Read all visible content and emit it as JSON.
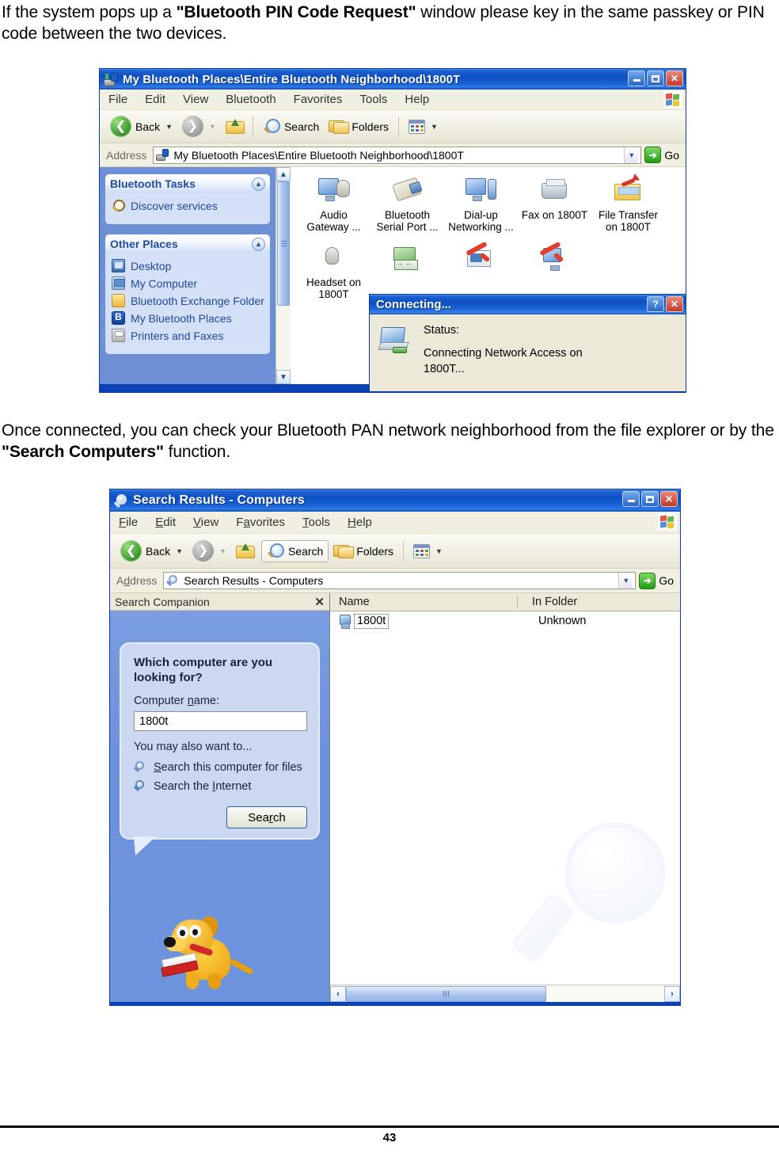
{
  "document": {
    "paragraph1_pre": "If the system pops up a ",
    "paragraph1_bold": "\"Bluetooth PIN Code Request\"",
    "paragraph1_post": " window please key in the same passkey or PIN code between the two devices.",
    "paragraph2_pre": "Once connected, you can check your Bluetooth PAN network neighborhood from the file explorer or by the ",
    "paragraph2_bold": "\"Search Computers\"",
    "paragraph2_post": " function.",
    "page_number": "43"
  },
  "window1": {
    "title": "My Bluetooth Places\\Entire Bluetooth Neighborhood\\1800T",
    "title_icon": "bluetooth-places-icon",
    "window_buttons": {
      "minimize": "minimize-button",
      "maximize": "maximize-button",
      "close": "close-button"
    },
    "menu": [
      "File",
      "Edit",
      "View",
      "Bluetooth",
      "Favorites",
      "Tools",
      "Help"
    ],
    "toolbar": {
      "back_label": "Back",
      "forward_label": "",
      "up_label": "",
      "search_label": "Search",
      "folders_label": "Folders",
      "views_label": ""
    },
    "address": {
      "label": "Address",
      "value": "My Bluetooth Places\\Entire Bluetooth Neighborhood\\1800T",
      "go_label": "Go"
    },
    "taskpanes": [
      {
        "header": "Bluetooth Tasks",
        "items": [
          {
            "icon": "magnifier-icon",
            "label": "Discover services"
          }
        ]
      },
      {
        "header": "Other Places",
        "items": [
          {
            "icon": "desktop-icon",
            "label": "Desktop"
          },
          {
            "icon": "my-computer-icon",
            "label": "My Computer"
          },
          {
            "icon": "folder-icon",
            "label": "Bluetooth Exchange Folder"
          },
          {
            "icon": "bluetooth-icon",
            "label": "My Bluetooth Places"
          },
          {
            "icon": "printer-icon",
            "label": "Printers and Faxes"
          }
        ]
      }
    ],
    "devices": [
      {
        "icon": "audio-gateway-icon",
        "label_line1": "Audio",
        "label_line2": "Gateway ..."
      },
      {
        "icon": "serial-port-icon",
        "label_line1": "Bluetooth",
        "label_line2": "Serial Port ..."
      },
      {
        "icon": "dialup-networking-icon",
        "label_line1": "Dial-up",
        "label_line2": "Networking ..."
      },
      {
        "icon": "fax-icon",
        "label_line1": "Fax on 1800T",
        "label_line2": ""
      },
      {
        "icon": "file-transfer-icon",
        "label_line1": "File Transfer",
        "label_line2": "on 1800T"
      },
      {
        "icon": "headset-icon",
        "label_line1": "Headset on",
        "label_line2": "1800T"
      },
      {
        "icon": "network-access-icon",
        "label_line1": "",
        "label_line2": ""
      },
      {
        "icon": "pim-item-transfer-icon",
        "label_line1": "",
        "label_line2": ""
      },
      {
        "icon": "pim-synchronization-icon",
        "label_line1": "",
        "label_line2": ""
      }
    ]
  },
  "dialog": {
    "title": "Connecting...",
    "help_label": "?",
    "close_label": "✕",
    "status_label": "Status:",
    "status_text": "Connecting Network Access on 1800T...",
    "icon": "network-connection-icon"
  },
  "window2": {
    "title": "Search Results  - Computers",
    "title_icon": "search-results-icon",
    "menu": [
      "File",
      "Edit",
      "View",
      "Favorites",
      "Tools",
      "Help"
    ],
    "toolbar": {
      "back_label": "Back",
      "search_label": "Search",
      "folders_label": "Folders"
    },
    "address": {
      "label": "Address",
      "value": "Search Results - Computers",
      "go_label": "Go"
    },
    "search_companion": {
      "header": "Search Companion",
      "close_label": "✕",
      "question": "Which computer are you looking for?",
      "name_label": "Computer name:",
      "name_value": "1800t",
      "also_label": "You may also want to...",
      "links": [
        {
          "icon": "search-files-icon",
          "label": "Search this computer for files"
        },
        {
          "icon": "search-internet-icon",
          "label": "Search the Internet"
        }
      ],
      "search_button": "Search",
      "mascot": "dog-mascot-icon"
    },
    "results": {
      "columns": [
        "Name",
        "In Folder"
      ],
      "rows": [
        {
          "name": "1800t",
          "in_folder": "Unknown",
          "icon": "computer-icon"
        }
      ],
      "watermark": "magnifier-watermark-icon"
    },
    "hscrollbar": {
      "left_label": "‹",
      "right_label": "›"
    }
  },
  "colors": {
    "xp_title_blue": "#0d4fc4",
    "taskpane_blue": "#6c8fd6",
    "taskpane_group": "#d4e0f5",
    "dialog_face": "#ece9d8",
    "accent_link": "#22499b"
  }
}
